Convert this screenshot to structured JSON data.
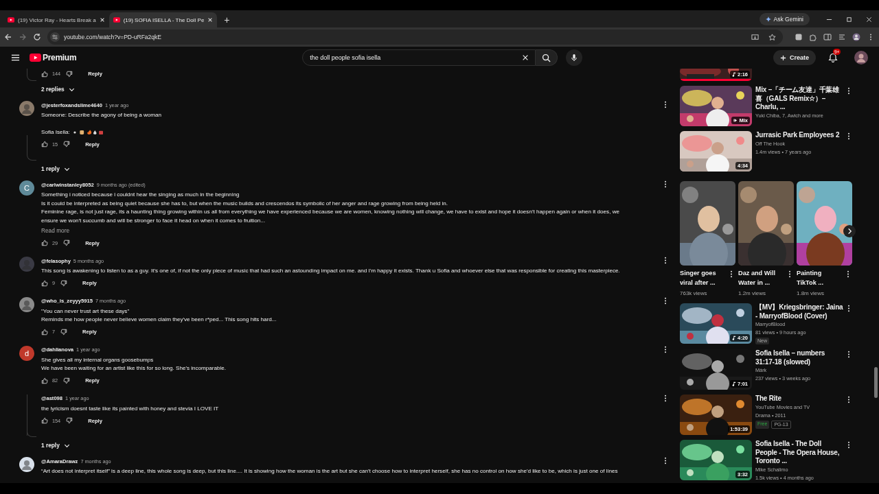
{
  "browser": {
    "tabs": [
      {
        "title": "(19) Victor Ray - Hearts Break a",
        "selected": false
      },
      {
        "title": "(19) SOFIA ISELLA - The Doll Pe",
        "selected": true
      }
    ],
    "new_tab": "+",
    "ask_gemini": "Ask Gemini",
    "url": "youtube.com/watch?v=PD-uRFa2qkE",
    "forward_disabled": true
  },
  "header": {
    "logo": "Premium",
    "search": {
      "value": "the doll people sofia isella"
    },
    "create": "Create",
    "notifications": "9+"
  },
  "comments": [
    {
      "kind": "actions",
      "likes": "144",
      "reply": "Reply"
    },
    {
      "kind": "toggle",
      "label": "2 replies"
    },
    {
      "kind": "comment",
      "handle": "@jesterfoxandslime4640",
      "time": "1 year ago",
      "avatar": {
        "kind": "picture",
        "color": "#8a7a6a"
      },
      "paragraphs": [
        [
          "Someone: Describe the agony of being a woman"
        ],
        [
          "Sofia Isella:"
        ]
      ],
      "emoji": true,
      "likes": "15",
      "reply": "Reply"
    },
    {
      "kind": "toggle",
      "label": "1 reply"
    },
    {
      "kind": "comment",
      "handle": "@carlwinstanley8052",
      "time": "9 months ago (edited)",
      "avatar": {
        "kind": "letter",
        "letter": "C",
        "color": "#5f8a99"
      },
      "paragraphs": [
        [
          "Something i noticed because i couldnt hear the singing as much in the beginning",
          "Is it could be interpreted as being quiet because she has to, but when the music builds and crescendos its symbolic of her anger and rage growing from being held in.",
          "Feminine rage, is not just rage, its a haunting thing growing within us all from everything we have experienced because we are women, knowing nothing will change, we have to exist and hope it doesn't happen again or when it does, we",
          "ensure we won't succumb and will be stronger to face it head on when it comes to fruition..."
        ]
      ],
      "read_more": "Read more",
      "likes": "29",
      "reply": "Reply"
    },
    {
      "kind": "comment",
      "handle": "@felasophy",
      "time": "5 months ago",
      "avatar": {
        "kind": "picture",
        "color": "#3a3a44"
      },
      "paragraphs": [
        [
          "This song is awakening to listen to as a guy. It's one of, if not the only piece of music that had such an astounding impact on me. and I'm happy it exists. Thank u Sofia and whoever else that was responsible for creating this masterpiece."
        ]
      ],
      "likes": "9",
      "reply": "Reply"
    },
    {
      "kind": "comment",
      "handle": "@who_is_zeyyy5915",
      "time": "7 months ago",
      "avatar": {
        "kind": "picture",
        "color": "#8a8a8a"
      },
      "paragraphs": [
        [
          "\"You can never trust art these days\"",
          "Reminds me how people never believe women claim they've been r*ped... This song hits hard..."
        ]
      ],
      "likes": "7",
      "reply": "Reply"
    },
    {
      "kind": "comment",
      "handle": "@dahlianova",
      "time": "1 year ago",
      "avatar": {
        "kind": "letter",
        "letter": "d",
        "color": "#c0392b"
      },
      "paragraphs": [
        [
          "She gives all my internal organs goosebumps",
          "We have been waiting for an artist like this for so long. She's incomparable."
        ]
      ],
      "likes": "82",
      "reply": "Reply"
    },
    {
      "kind": "comment",
      "handle": "@ast098",
      "time": "1 year ago",
      "paragraphs": [
        [
          "the lyricism doesnt taste like its painted with honey and stevia I LOVE IT"
        ]
      ],
      "likes": "154",
      "reply": "Reply"
    },
    {
      "kind": "toggle",
      "label": "1 reply"
    },
    {
      "kind": "comment",
      "handle": "@AmaraDrawz",
      "time": "7 months ago",
      "avatar": {
        "kind": "picture",
        "color": "#d8e0ea"
      },
      "paragraphs": [
        [
          "“Art does not interpret  itself” is a deep line, this whole song is deep, but this line.... It is showing how the woman is the art but she can't choose how to interpret herself, she has no control on how she'd like to be, which is just one of lines"
        ]
      ]
    }
  ],
  "sidebar": [
    {
      "kind": "partial",
      "duration": "2:16",
      "music": true,
      "level": 1
    },
    {
      "kind": "video",
      "title": "Mix –「チーム友達」千葉雄喜（GALS Remix☆）– Charlu, ...",
      "channel": "Yuki Chiba, 7, Awich and more",
      "mix": "Mix"
    },
    {
      "kind": "video",
      "title": "Jurrasic Park Employees 2",
      "channel": "Off The Hook",
      "meta": "1.4m views • 7 years ago",
      "duration": "4:34"
    },
    {
      "kind": "shorts",
      "items": [
        {
          "title": "Singer goes viral after ...",
          "views": "763k views"
        },
        {
          "title": "Daz and Will Water in ...",
          "views": "1.2m views"
        },
        {
          "title": "Painting TikTok ...",
          "views": "1.8m views"
        }
      ]
    },
    {
      "kind": "video",
      "title": "【MV】Kriegsbringer: Jaina - MarryofBlood (Cover)",
      "channel": "MarryofBlood",
      "meta": "81 views • 9 hours ago",
      "duration": "4:20",
      "music": true,
      "badges": [
        {
          "kind": "new",
          "text": "New"
        }
      ]
    },
    {
      "kind": "video",
      "title": "Sofia Isella – numbers 31:17-18 (slowed)",
      "channel": "Márk",
      "meta": "237 views • 3 weeks ago",
      "duration": "7:01",
      "music": true
    },
    {
      "kind": "video",
      "title": "The Rite",
      "channel": "YouTube Movies and TV",
      "meta": "Drama • 2011",
      "duration": "1:53:39",
      "badges": [
        {
          "kind": "free",
          "text": "Free"
        },
        {
          "kind": "rating",
          "text": "PG-13"
        }
      ]
    },
    {
      "kind": "video",
      "title": "Sofia Isella - The Doll People - The Opera House, Toronto ...",
      "channel": "Mike Schalimo",
      "meta": "1.5k views • 4 months ago",
      "duration": "3:32"
    }
  ]
}
